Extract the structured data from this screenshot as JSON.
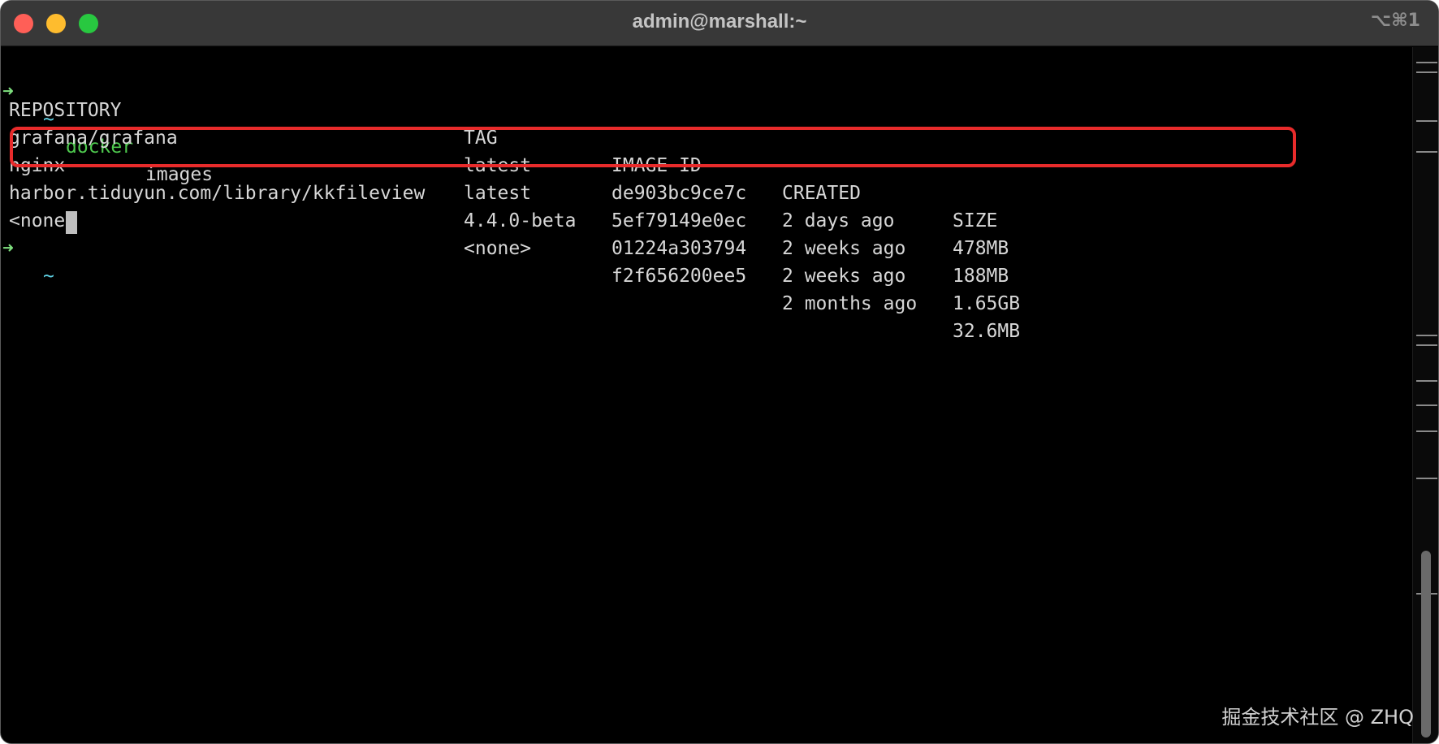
{
  "window": {
    "title": "admin@marshall:~",
    "shortcut": "⌥⌘1"
  },
  "terminal": {
    "prompt_arrow": "➜",
    "prompt_tilde": "~",
    "command": "docker",
    "command_args": "images",
    "headers": [
      "REPOSITORY",
      "TAG",
      "IMAGE ID",
      "CREATED",
      "SIZE"
    ],
    "rows": [
      {
        "repository": "grafana/grafana",
        "tag": "latest",
        "image_id": "de903bc9ce7c",
        "created": "2 days ago",
        "size": "478MB"
      },
      {
        "repository": "nginx",
        "tag": "latest",
        "image_id": "5ef79149e0ec",
        "created": "2 weeks ago",
        "size": "188MB"
      },
      {
        "repository": "harbor.tiduyun.com/library/kkfileview",
        "tag": "4.4.0-beta",
        "image_id": "01224a303794",
        "created": "2 weeks ago",
        "size": "1.65GB"
      },
      {
        "repository": "<none>",
        "tag": "<none>",
        "image_id": "f2f656200ee5",
        "created": "2 months ago",
        "size": "32.6MB"
      }
    ]
  },
  "watermark": "掘金技术社区 @ ZHQ",
  "colors": {
    "highlight_border": "#e82b2b",
    "prompt_green": "#7fe07f",
    "command_green": "#4ec94e",
    "tilde_cyan": "#5fd3e6"
  },
  "icons": [
    "close-icon",
    "minimize-icon",
    "zoom-icon"
  ]
}
